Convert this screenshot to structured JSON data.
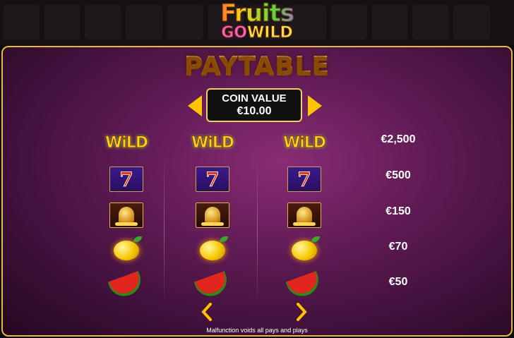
{
  "game": {
    "logo_line1": "Fruits",
    "logo_go": "GO",
    "logo_wild": "WILD"
  },
  "paytable": {
    "title": "PAYTABLE",
    "coin_value_label": "COIN VALUE",
    "coin_value": "€10.00",
    "rows": [
      {
        "symbol": "wild-symbol-icon",
        "payout": "€2,500",
        "wild_text": "WiLD"
      },
      {
        "symbol": "seven-symbol-icon",
        "payout": "€500",
        "seven_text": "7"
      },
      {
        "symbol": "bell-symbol-icon",
        "payout": "€150"
      },
      {
        "symbol": "lemon-symbol-icon",
        "payout": "€70"
      },
      {
        "symbol": "watermelon-symbol-icon",
        "payout": "€50"
      }
    ],
    "disclaimer": "Malfunction voids all pays and plays"
  },
  "colors": {
    "accent_gold": "#ffc300",
    "panel_purple": "#5d1a52",
    "border_gold": "#e9b93b"
  }
}
